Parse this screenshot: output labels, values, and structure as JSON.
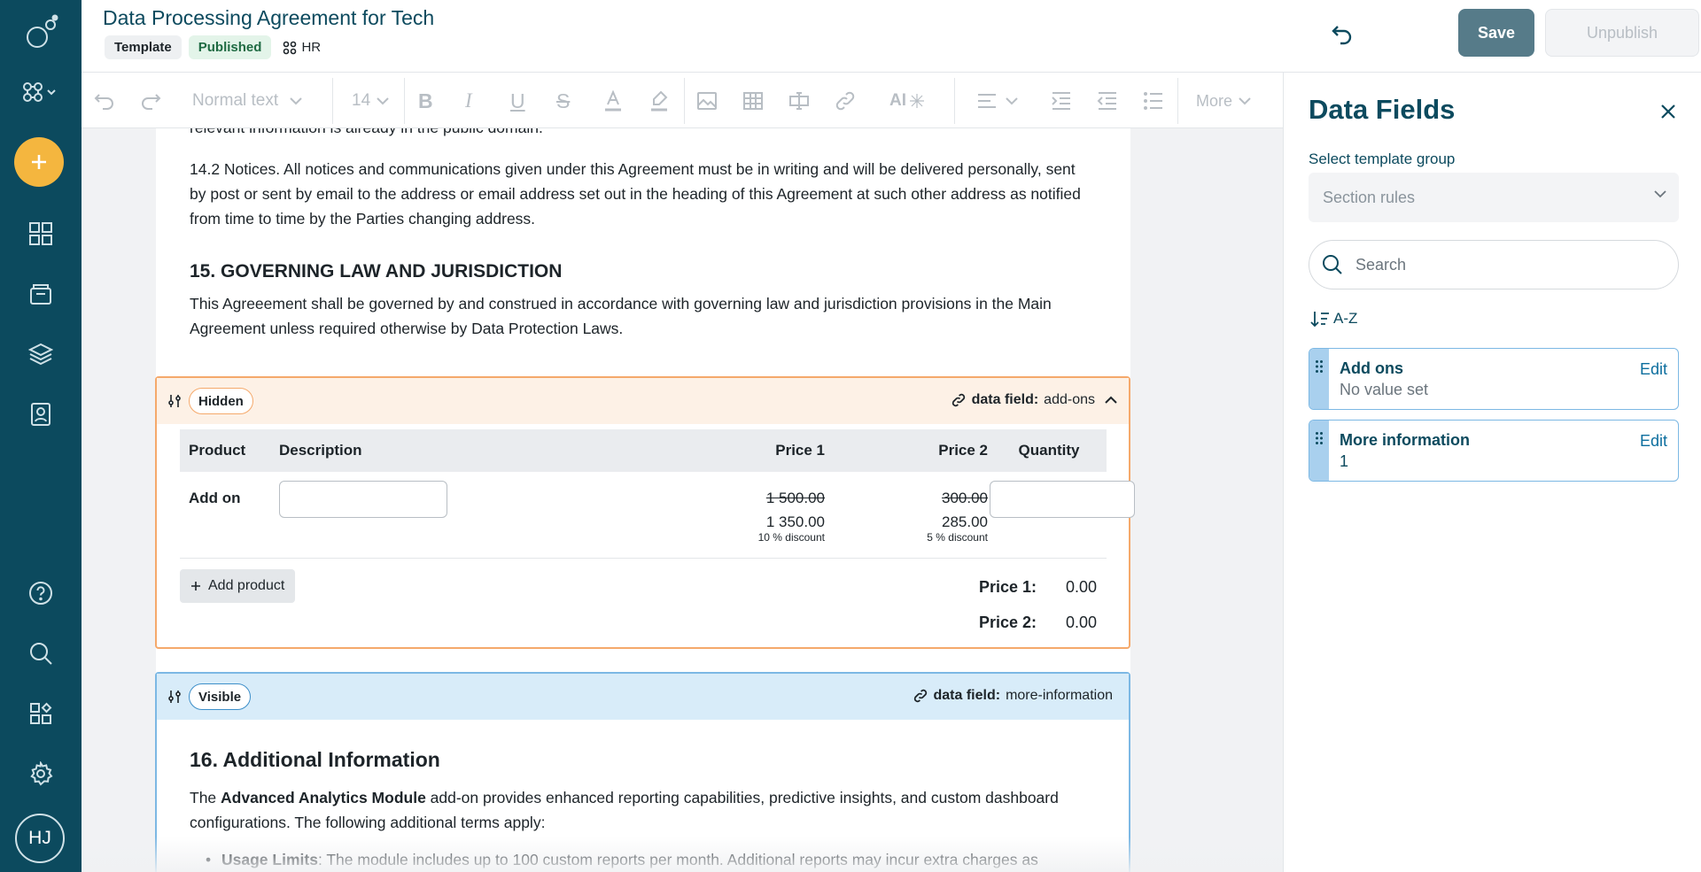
{
  "header": {
    "title": "Data Processing Agreement for Tech",
    "chip_template": "Template",
    "chip_published": "Published",
    "chip_group": "HR",
    "save_label": "Save",
    "unpublish_label": "Unpublish"
  },
  "toolbar": {
    "text_style": "Normal text",
    "font_size": "14",
    "ai_label": "AI",
    "more_label": "More"
  },
  "document": {
    "para_public": "relevant information is already in the public domain.",
    "para_notices": "14.2 Notices. All notices and communications given under this Agreement must be in writing and will be delivered personally, sent by post or sent by email to the address or email address set out in the heading of this Agreement at such other address as notified from time to time by the Parties changing address.",
    "heading_15": "15. GOVERNING LAW AND JURISDICTION",
    "para_15": "This Agreeement shall be governed by and construed in accordance with governing law and jurisdiction provisions in the Main Agreement unless required otherwise by Data Protection Laws.",
    "hidden_section": {
      "badge": "Hidden",
      "field_prefix": "data field:",
      "field_name": "add-ons",
      "table": {
        "headers": [
          "Product",
          "Description",
          "Price 1",
          "Price 2",
          "Quantity"
        ],
        "row": {
          "product": "Add on",
          "price1_original": "1 500.00",
          "price1_final": "1 350.00",
          "price1_discount": "10 % discount",
          "price2_original": "300.00",
          "price2_final": "285.00",
          "price2_discount": "5 % discount"
        }
      },
      "add_product": "Add product",
      "total1_label": "Price 1:",
      "total1_value": "0.00",
      "total2_label": "Price 2:",
      "total2_value": "0.00"
    },
    "visible_section": {
      "badge": "Visible",
      "field_prefix": "data field:",
      "field_name": "more-information",
      "heading_16": "16. Additional Information",
      "para_16_pre": "The ",
      "para_16_bold": "Advanced Analytics Module",
      "para_16_post": " add-on provides enhanced reporting capabilities, predictive insights, and custom dashboard configurations. The following additional terms apply:",
      "bullet_bold": "Usage Limits",
      "bullet_text": ": The module includes up to 100 custom reports per month. Additional reports may incur extra charges as"
    }
  },
  "panel": {
    "title": "Data Fields",
    "group_label": "Select template group",
    "group_value": "Section rules",
    "search_placeholder": "Search",
    "sort_label": "A-Z",
    "fields": [
      {
        "name": "Add ons",
        "value": "No value set",
        "edit": "Edit"
      },
      {
        "name": "More information",
        "value": "1",
        "edit": "Edit"
      }
    ]
  },
  "user": {
    "initials": "HJ"
  },
  "colors": {
    "rail": "#0c4a5e",
    "accent_add": "#f4b63f",
    "hidden_border": "#f5a96b",
    "visible_border": "#7cb8e4",
    "save_button": "#567b89"
  }
}
